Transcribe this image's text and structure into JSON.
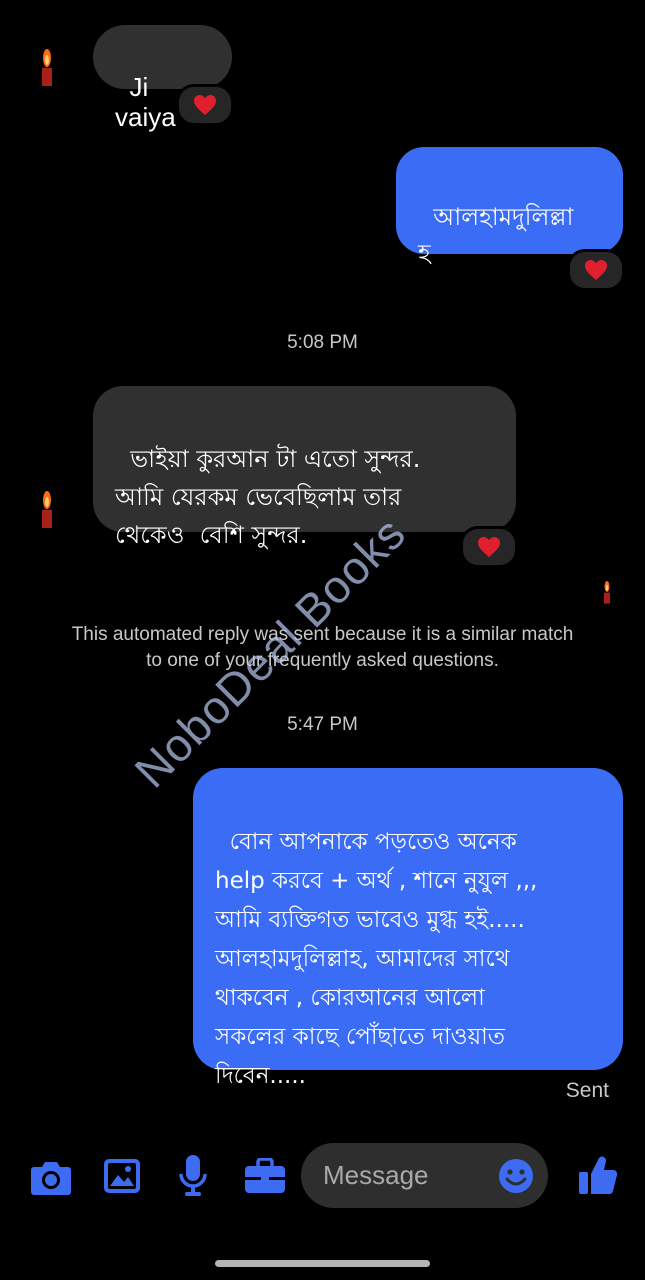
{
  "messages": {
    "m1_text": "Ji vaiya",
    "m2_text": "আলহামদুলিল্লা\nহ",
    "time1": "5:08 PM",
    "m3_text": "ভাইয়া কুরআন টা এতো সুন্দর.\nআমি যেরকম ভেবেছিলাম তার\nথেকেও  বেশি সুন্দর.",
    "auto_reply_note": "This automated reply was sent because it is a similar match\nto one of your frequently asked questions.",
    "time2": "5:47 PM",
    "m4_text": "বোন আপনাকে পড়তেও অনেক\nhelp করবে + অর্থ , শানে নুযুল ,,,\nআমি ব্যক্তিগত ভাবেও মুগ্ধ হই.....\nআলহামদুলিল্লাহ, আমাদের সাথে\nথাকবেন , কোরআনের আলো\nসকলের কাছে পোঁছাতে দাওয়াত\nদিবেন.....",
    "status": "Sent",
    "reaction": "heart"
  },
  "composer": {
    "placeholder": "Message",
    "icons": [
      "camera-icon",
      "gallery-icon",
      "microphone-icon",
      "briefcase-icon",
      "emoji-icon",
      "thumbs-up-icon"
    ]
  },
  "watermark": "NoboDeal Books",
  "colors": {
    "background": "#000000",
    "incoming_bubble": "#303030",
    "outgoing_bubble": "#3a6cf5",
    "accent": "#3d6cf2",
    "heart": "#e0202e"
  }
}
